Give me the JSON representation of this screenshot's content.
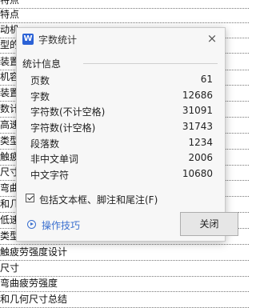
{
  "document": {
    "lines": [
      "特点",
      "动机",
      "型的",
      "装置",
      "机容",
      "装置",
      "数计",
      "高速",
      "类型",
      "触疲",
      "尺寸",
      "弯曲",
      "和几",
      "低速",
      "类型",
      "触疲劳强度设计",
      "尺寸",
      "弯曲疲劳强度",
      "和几何尺寸总结"
    ]
  },
  "dialog": {
    "app_icon": "W",
    "title": "字数统计",
    "close_icon": "×",
    "section_title": "统计信息",
    "stats": [
      {
        "label": "页数",
        "value": "61"
      },
      {
        "label": "字数",
        "value": "12686"
      },
      {
        "label": "字符数(不计空格)",
        "value": "31091"
      },
      {
        "label": "字符数(计空格)",
        "value": "31743"
      },
      {
        "label": "段落数",
        "value": "1234"
      },
      {
        "label": "非中文单词",
        "value": "2006"
      },
      {
        "label": "中文字符",
        "value": "10680"
      }
    ],
    "checkbox": {
      "label": "包括文本框、脚注和尾注(F)",
      "checked": true
    },
    "tips_label": "操作技巧",
    "close_button": "关闭"
  }
}
